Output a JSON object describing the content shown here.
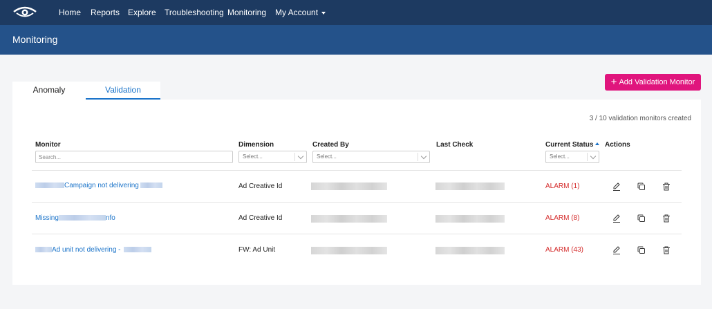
{
  "nav": {
    "logo_icon": "eye-logo-icon",
    "items": [
      {
        "label": "Home"
      },
      {
        "label": "Reports"
      },
      {
        "label": "Explore"
      },
      {
        "label": "Troubleshooting"
      },
      {
        "label": "Monitoring"
      },
      {
        "label": "My Account"
      }
    ]
  },
  "header": {
    "title": "Monitoring"
  },
  "add_button": {
    "label": "Add Validation Monitor",
    "icon": "plus-icon"
  },
  "tabs": [
    {
      "label": "Anomaly",
      "active": false
    },
    {
      "label": "Validation",
      "active": true
    }
  ],
  "summary": "3 / 10 validation monitors created",
  "table": {
    "columns": {
      "monitor": "Monitor",
      "dimension": "Dimension",
      "created_by": "Created By",
      "last_check": "Last Check",
      "current_status": "Current Status",
      "actions": "Actions"
    },
    "filters": {
      "search_placeholder": "Search...",
      "dimension_select": "Select...",
      "created_by_select": "Select...",
      "status_select": "Select..."
    },
    "rows": [
      {
        "monitor": "Campaign not delivering",
        "dimension": "Ad Creative Id",
        "status": "ALARM (1)"
      },
      {
        "monitor_prefix": "Missing",
        "monitor_suffix": "nfo",
        "dimension": "Ad Creative Id",
        "status": "ALARM (8)"
      },
      {
        "monitor": "Ad unit not delivering -",
        "dimension": "FW: Ad Unit",
        "status": "ALARM (43)"
      }
    ],
    "action_icons": [
      "edit-icon",
      "copy-icon",
      "delete-icon"
    ]
  },
  "colors": {
    "nav_bg": "#1d3a61",
    "header_bg": "#24528a",
    "accent": "#e0157d",
    "link": "#1a73c9",
    "alarm": "#d42a2a"
  }
}
